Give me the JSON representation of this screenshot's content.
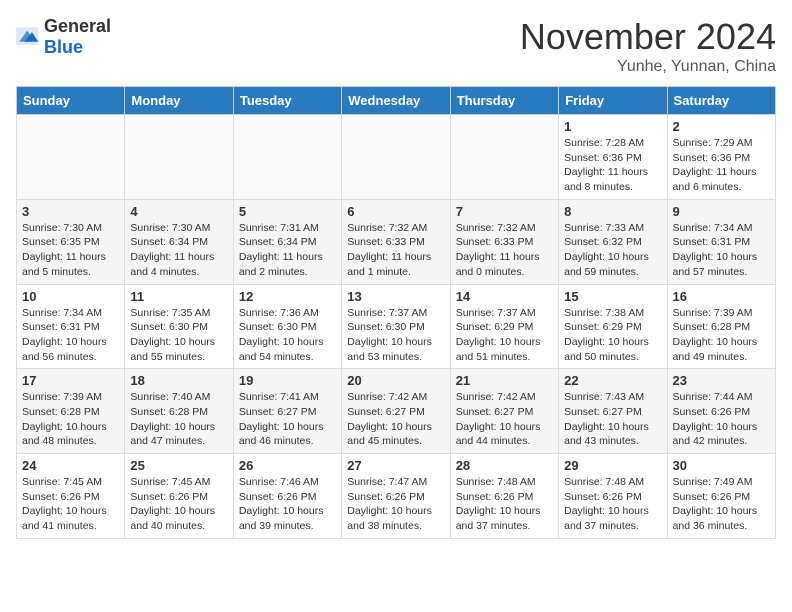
{
  "header": {
    "logo_general": "General",
    "logo_blue": "Blue",
    "month_year": "November 2024",
    "location": "Yunhe, Yunnan, China"
  },
  "days_of_week": [
    "Sunday",
    "Monday",
    "Tuesday",
    "Wednesday",
    "Thursday",
    "Friday",
    "Saturday"
  ],
  "weeks": [
    [
      {
        "day": "",
        "info": ""
      },
      {
        "day": "",
        "info": ""
      },
      {
        "day": "",
        "info": ""
      },
      {
        "day": "",
        "info": ""
      },
      {
        "day": "",
        "info": ""
      },
      {
        "day": "1",
        "info": "Sunrise: 7:28 AM\nSunset: 6:36 PM\nDaylight: 11 hours and 8 minutes."
      },
      {
        "day": "2",
        "info": "Sunrise: 7:29 AM\nSunset: 6:36 PM\nDaylight: 11 hours and 6 minutes."
      }
    ],
    [
      {
        "day": "3",
        "info": "Sunrise: 7:30 AM\nSunset: 6:35 PM\nDaylight: 11 hours and 5 minutes."
      },
      {
        "day": "4",
        "info": "Sunrise: 7:30 AM\nSunset: 6:34 PM\nDaylight: 11 hours and 4 minutes."
      },
      {
        "day": "5",
        "info": "Sunrise: 7:31 AM\nSunset: 6:34 PM\nDaylight: 11 hours and 2 minutes."
      },
      {
        "day": "6",
        "info": "Sunrise: 7:32 AM\nSunset: 6:33 PM\nDaylight: 11 hours and 1 minute."
      },
      {
        "day": "7",
        "info": "Sunrise: 7:32 AM\nSunset: 6:33 PM\nDaylight: 11 hours and 0 minutes."
      },
      {
        "day": "8",
        "info": "Sunrise: 7:33 AM\nSunset: 6:32 PM\nDaylight: 10 hours and 59 minutes."
      },
      {
        "day": "9",
        "info": "Sunrise: 7:34 AM\nSunset: 6:31 PM\nDaylight: 10 hours and 57 minutes."
      }
    ],
    [
      {
        "day": "10",
        "info": "Sunrise: 7:34 AM\nSunset: 6:31 PM\nDaylight: 10 hours and 56 minutes."
      },
      {
        "day": "11",
        "info": "Sunrise: 7:35 AM\nSunset: 6:30 PM\nDaylight: 10 hours and 55 minutes."
      },
      {
        "day": "12",
        "info": "Sunrise: 7:36 AM\nSunset: 6:30 PM\nDaylight: 10 hours and 54 minutes."
      },
      {
        "day": "13",
        "info": "Sunrise: 7:37 AM\nSunset: 6:30 PM\nDaylight: 10 hours and 53 minutes."
      },
      {
        "day": "14",
        "info": "Sunrise: 7:37 AM\nSunset: 6:29 PM\nDaylight: 10 hours and 51 minutes."
      },
      {
        "day": "15",
        "info": "Sunrise: 7:38 AM\nSunset: 6:29 PM\nDaylight: 10 hours and 50 minutes."
      },
      {
        "day": "16",
        "info": "Sunrise: 7:39 AM\nSunset: 6:28 PM\nDaylight: 10 hours and 49 minutes."
      }
    ],
    [
      {
        "day": "17",
        "info": "Sunrise: 7:39 AM\nSunset: 6:28 PM\nDaylight: 10 hours and 48 minutes."
      },
      {
        "day": "18",
        "info": "Sunrise: 7:40 AM\nSunset: 6:28 PM\nDaylight: 10 hours and 47 minutes."
      },
      {
        "day": "19",
        "info": "Sunrise: 7:41 AM\nSunset: 6:27 PM\nDaylight: 10 hours and 46 minutes."
      },
      {
        "day": "20",
        "info": "Sunrise: 7:42 AM\nSunset: 6:27 PM\nDaylight: 10 hours and 45 minutes."
      },
      {
        "day": "21",
        "info": "Sunrise: 7:42 AM\nSunset: 6:27 PM\nDaylight: 10 hours and 44 minutes."
      },
      {
        "day": "22",
        "info": "Sunrise: 7:43 AM\nSunset: 6:27 PM\nDaylight: 10 hours and 43 minutes."
      },
      {
        "day": "23",
        "info": "Sunrise: 7:44 AM\nSunset: 6:26 PM\nDaylight: 10 hours and 42 minutes."
      }
    ],
    [
      {
        "day": "24",
        "info": "Sunrise: 7:45 AM\nSunset: 6:26 PM\nDaylight: 10 hours and 41 minutes."
      },
      {
        "day": "25",
        "info": "Sunrise: 7:45 AM\nSunset: 6:26 PM\nDaylight: 10 hours and 40 minutes."
      },
      {
        "day": "26",
        "info": "Sunrise: 7:46 AM\nSunset: 6:26 PM\nDaylight: 10 hours and 39 minutes."
      },
      {
        "day": "27",
        "info": "Sunrise: 7:47 AM\nSunset: 6:26 PM\nDaylight: 10 hours and 38 minutes."
      },
      {
        "day": "28",
        "info": "Sunrise: 7:48 AM\nSunset: 6:26 PM\nDaylight: 10 hours and 37 minutes."
      },
      {
        "day": "29",
        "info": "Sunrise: 7:48 AM\nSunset: 6:26 PM\nDaylight: 10 hours and 37 minutes."
      },
      {
        "day": "30",
        "info": "Sunrise: 7:49 AM\nSunset: 6:26 PM\nDaylight: 10 hours and 36 minutes."
      }
    ]
  ]
}
